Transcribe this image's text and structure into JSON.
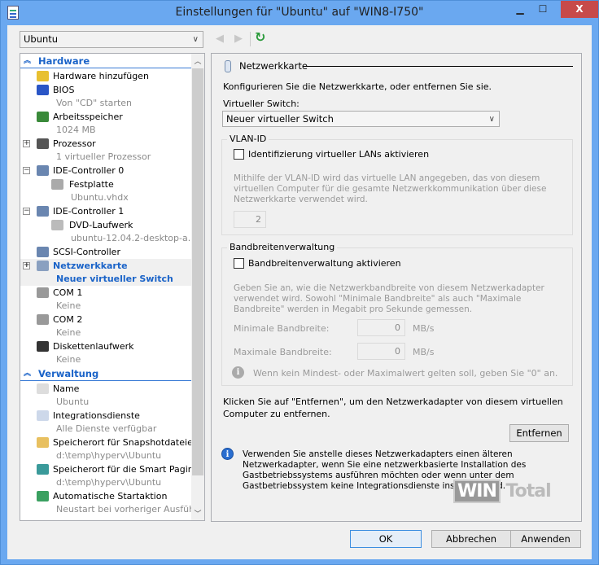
{
  "window": {
    "title": "Einstellungen für \"Ubuntu\" auf \"WIN8-I750\"",
    "minimize": "▁",
    "maximize": "☐",
    "close": "X"
  },
  "vm_select": {
    "value": "Ubuntu"
  },
  "tree": {
    "sections": [
      {
        "label": "Hardware",
        "items": [
          {
            "label": "Hardware hinzufügen",
            "icon": "add-hardware-icon",
            "color": "#e8c030"
          },
          {
            "label": "BIOS",
            "sub": "Von \"CD\" starten",
            "icon": "bios-icon",
            "color": "#2a56c6"
          },
          {
            "label": "Arbeitsspeicher",
            "sub": "1024 MB",
            "icon": "memory-icon",
            "color": "#3a8a3a"
          },
          {
            "label": "Prozessor",
            "sub": "1 virtueller Prozessor",
            "icon": "processor-icon",
            "color": "#555",
            "expander": "+"
          },
          {
            "label": "IDE-Controller 0",
            "icon": "ide-controller-icon",
            "color": "#6a86b0",
            "expander": "−"
          },
          {
            "label": "Festplatte",
            "sub": "Ubuntu.vhdx",
            "icon": "hard-disk-icon",
            "color": "#aaa",
            "level": 2
          },
          {
            "label": "IDE-Controller 1",
            "icon": "ide-controller-icon",
            "color": "#6a86b0",
            "expander": "−"
          },
          {
            "label": "DVD-Laufwerk",
            "sub": "ubuntu-12.04.2-desktop-a...",
            "icon": "dvd-drive-icon",
            "color": "#bbb",
            "level": 2
          },
          {
            "label": "SCSI-Controller",
            "icon": "scsi-controller-icon",
            "color": "#6a86b0"
          },
          {
            "label": "Netzwerkkarte",
            "sub": "Neuer virtueller Switch",
            "icon": "network-adapter-icon",
            "color": "#8aa0c0",
            "expander": "+",
            "selected": true
          },
          {
            "label": "COM 1",
            "sub": "Keine",
            "icon": "com-port-icon",
            "color": "#999"
          },
          {
            "label": "COM 2",
            "sub": "Keine",
            "icon": "com-port-icon",
            "color": "#999"
          },
          {
            "label": "Diskettenlaufwerk",
            "sub": "Keine",
            "icon": "floppy-icon",
            "color": "#333"
          }
        ]
      },
      {
        "label": "Verwaltung",
        "items": [
          {
            "label": "Name",
            "sub": "Ubuntu",
            "icon": "name-icon",
            "color": "#ddd"
          },
          {
            "label": "Integrationsdienste",
            "sub": "Alle Dienste verfügbar",
            "icon": "integration-services-icon",
            "color": "#cdd8ea"
          },
          {
            "label": "Speicherort für Snapshotdateien",
            "sub": "d:\\temp\\hyperv\\Ubuntu",
            "icon": "snapshot-folder-icon",
            "color": "#e8c060"
          },
          {
            "label": "Speicherort für die Smart Pagin...",
            "sub": "d:\\temp\\hyperv\\Ubuntu",
            "icon": "smart-paging-icon",
            "color": "#3a9a9a"
          },
          {
            "label": "Automatische Startaktion",
            "sub": "Neustart bei vorheriger Ausfüh...",
            "icon": "auto-start-icon",
            "color": "#3aa060"
          }
        ]
      }
    ]
  },
  "panel": {
    "title": "Netzwerkkarte",
    "intro": "Konfigurieren Sie die Netzwerkkarte, oder entfernen Sie sie.",
    "switch_label": "Virtueller Switch:",
    "switch_value": "Neuer virtueller Switch",
    "vlan": {
      "legend": "VLAN-ID",
      "checkbox": "Identifizierung virtueller LANs aktivieren",
      "help": "Mithilfe der VLAN-ID wird das virtuelle LAN angegeben, das von diesem virtuellen Computer für die gesamte Netzwerkkommunikation über diese Netzwerkkarte verwendet wird.",
      "value": "2"
    },
    "bandwidth": {
      "legend": "Bandbreitenverwaltung",
      "checkbox": "Bandbreitenverwaltung aktivieren",
      "help": "Geben Sie an, wie die Netzwerkbandbreite von diesem Netzwerkadapter verwendet wird. Sowohl \"Minimale Bandbreite\" als auch \"Maximale Bandbreite\" werden in Megabit pro Sekunde gemessen.",
      "min_label": "Minimale Bandbreite:",
      "min_value": "0",
      "max_label": "Maximale Bandbreite:",
      "max_value": "0",
      "unit": "MB/s",
      "note": "Wenn kein Mindest- oder Maximalwert gelten soll, geben Sie \"0\" an."
    },
    "remove_text": "Klicken Sie auf \"Entfernen\", um den Netzwerkadapter von diesem virtuellen Computer zu entfernen.",
    "remove_button": "Entfernen",
    "legacy_info": "Verwenden Sie anstelle dieses Netzwerkadapters einen älteren Netzwerkadapter, wenn Sie eine netzwerkbasierte Installation des Gastbetriebssystems ausführen möchten oder wenn unter dem Gastbetriebssystem keine Integrationsdienste installiert sind."
  },
  "buttons": {
    "ok": "OK",
    "cancel": "Abbrechen",
    "apply": "Anwenden"
  },
  "watermark": {
    "a": "WIN",
    "b": "Total"
  }
}
